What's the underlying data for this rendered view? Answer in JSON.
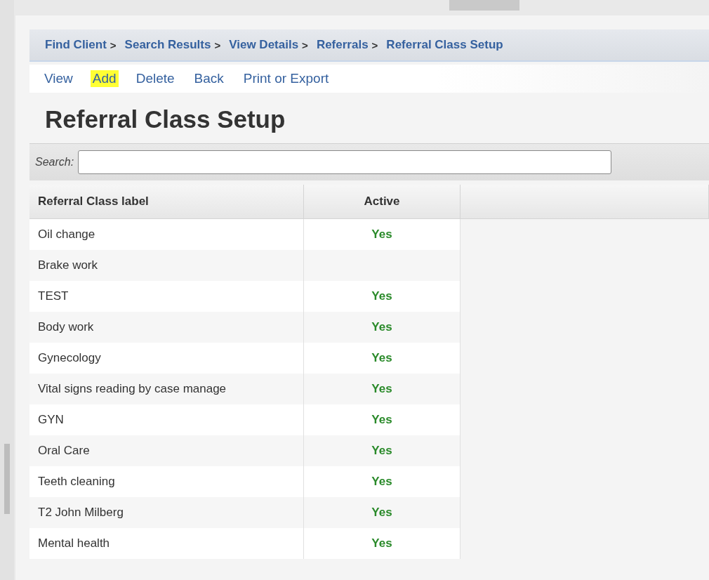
{
  "breadcrumbs": [
    {
      "label": "Find Client",
      "separator": ">"
    },
    {
      "label": "Search Results",
      "separator": ">"
    },
    {
      "label": "View Details",
      "separator": ">"
    },
    {
      "label": "Referrals",
      "separator": ">"
    },
    {
      "label": "Referral Class Setup"
    }
  ],
  "actions": [
    {
      "label": "View",
      "highlighted": false
    },
    {
      "label": "Add",
      "highlighted": true
    },
    {
      "label": "Delete",
      "highlighted": false
    },
    {
      "label": "Back",
      "highlighted": false
    },
    {
      "label": "Print or Export",
      "highlighted": false
    }
  ],
  "page_title": "Referral Class Setup",
  "search": {
    "label": "Search:"
  },
  "table": {
    "columns": [
      "Referral Class label",
      "Active"
    ],
    "rows": [
      {
        "label": "Oil change",
        "active": "Yes"
      },
      {
        "label": "Brake work"
      },
      {
        "label": "TEST",
        "active": "Yes"
      },
      {
        "label": "Body work",
        "active": "Yes"
      },
      {
        "label": "Gynecology",
        "active": "Yes"
      },
      {
        "label": "Vital signs reading by case manage",
        "active": "Yes"
      },
      {
        "label": "GYN",
        "active": "Yes"
      },
      {
        "label": "Oral Care",
        "active": "Yes"
      },
      {
        "label": "Teeth cleaning",
        "active": "Yes"
      },
      {
        "label": "T2 John Milberg",
        "active": "Yes"
      },
      {
        "label": "Mental health",
        "active": "Yes"
      }
    ]
  }
}
